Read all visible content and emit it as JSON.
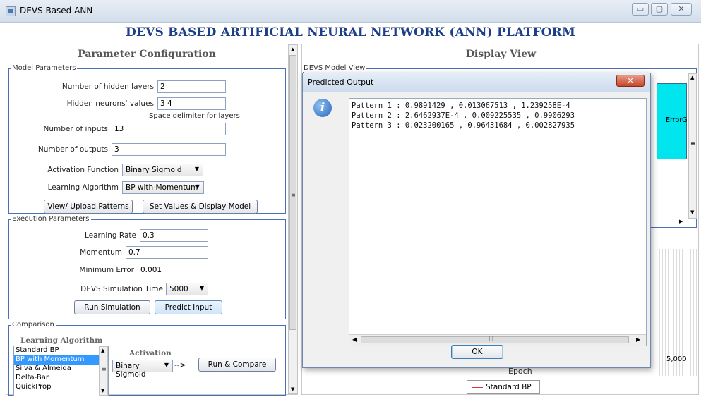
{
  "window": {
    "title": "DEVS Based ANN",
    "minimize_glyph": "▭",
    "maximize_glyph": "▢",
    "close_glyph": "✕"
  },
  "header": {
    "title": "DEVS BASED ARTIFICIAL NEURAL NETWORK (ANN) PLATFORM"
  },
  "left": {
    "title": "Parameter Configuration",
    "model": {
      "legend": "Model Parameters",
      "hidden_layers_label": "Number of hidden layers",
      "hidden_layers_value": "2",
      "hidden_neurons_label": "Hidden neurons' values",
      "hidden_neurons_value": "3 4",
      "hint": "Space delimiter for layers",
      "inputs_label": "Number of inputs",
      "inputs_value": "13",
      "outputs_label": "Number of outputs",
      "outputs_value": "3",
      "activation_label": "Activation Function",
      "activation_value": "Binary Sigmoid",
      "learning_label": "Learning Algorithm",
      "learning_value": "BP with Momentum",
      "view_button": "View/ Upload Patterns",
      "set_button": "Set Values & Display Model"
    },
    "execution": {
      "legend": "Execution Parameters",
      "lr_label": "Learning Rate",
      "lr_value": "0.3",
      "momentum_label": "Momentum",
      "momentum_value": "0.7",
      "min_error_label": "Minimum Error",
      "min_error_value": "0.001",
      "sim_time_label": "DEVS Simulation Time",
      "sim_time_value": "5000",
      "run_button": "Run Simulation",
      "predict_button": "Predict Input"
    },
    "comparison": {
      "legend": "Comparison",
      "algo_header": "Learning Algorithm",
      "algorithms": [
        "Standard BP",
        "BP with Momentum",
        "Silva & Almeida",
        "Delta-Bar",
        "QuickProp"
      ],
      "selected_algorithm": "BP with Momentum",
      "activation_header": "Activation",
      "activation_value": "Binary Sigmoid",
      "arrow": "-->",
      "run_compare_button": "Run & Compare"
    }
  },
  "right": {
    "title": "Display View",
    "model_view_legend": "DEVS Model View",
    "model_node_label": "ErrorGl",
    "chart_tick": "5,000",
    "chart_xlabel": "Epoch",
    "legend_entry": "Standard BP"
  },
  "dialog": {
    "title": "Predicted Output",
    "close_glyph": "✕",
    "icon_glyph": "i",
    "lines": [
      "Pattern 1 : 0.9891429 , 0.013067513 , 1.239258E-4",
      "Pattern 2 : 2.6462937E-4 , 0.009225535 , 0.9906293",
      "Pattern 3 : 0.023200165 , 0.96431684 , 0.002827935"
    ],
    "hscroll_thumb": "III",
    "ok_button": "OK"
  },
  "colors": {
    "accent": "#3399ff",
    "title_blue": "#1d3f8a",
    "group_border": "#4d6fb3",
    "node_cyan": "#00e5ee"
  }
}
